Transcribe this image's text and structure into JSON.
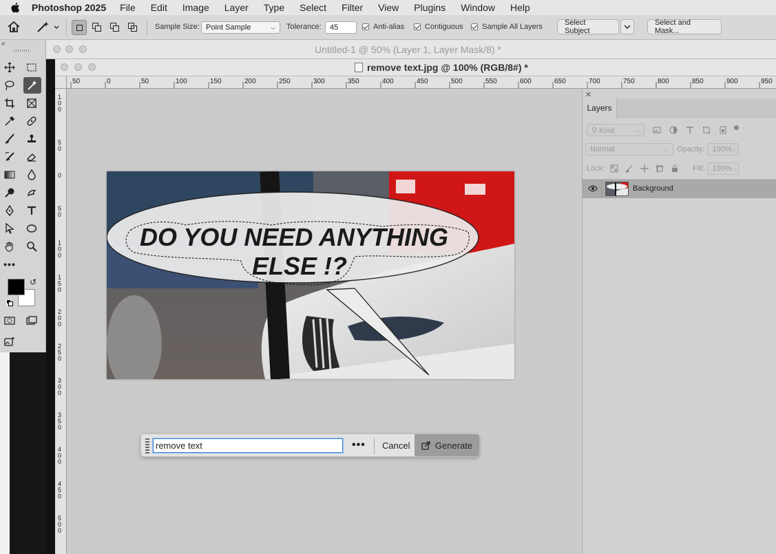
{
  "menubar": {
    "app_name": "Photoshop 2025",
    "items": [
      "File",
      "Edit",
      "Image",
      "Layer",
      "Type",
      "Select",
      "Filter",
      "View",
      "Plugins",
      "Window",
      "Help"
    ]
  },
  "options": {
    "sample_size_label": "Sample Size:",
    "sample_size_value": "Point Sample",
    "tolerance_label": "Tolerance:",
    "tolerance_value": "45",
    "anti_alias": "Anti-alias",
    "contiguous": "Contiguous",
    "sample_all_layers": "Sample All Layers",
    "select_subject": "Select Subject",
    "select_and_mask": "Select and Mask..."
  },
  "documents": {
    "back_title": "Untitled-1 @ 50% (Layer 1, Layer Mask/8) *",
    "front_title": "remove text.jpg @ 100% (RGB/8#) *"
  },
  "rulers": {
    "h_ticks": [
      "50",
      "0",
      "50",
      "100",
      "150",
      "200",
      "250",
      "300",
      "350",
      "400",
      "450",
      "500",
      "550",
      "600",
      "650",
      "700",
      "750",
      "800",
      "850",
      "900",
      "950"
    ],
    "v_ticks": [
      "100",
      "50",
      "0",
      "50",
      "100",
      "150",
      "200",
      "250",
      "300",
      "350",
      "400",
      "450",
      "500"
    ]
  },
  "image": {
    "bubble_line1": "DO YOU NEED ANYTHING",
    "bubble_line2": "ELSE !?"
  },
  "generate_bar": {
    "prompt_value": "remove text",
    "more_label": "•••",
    "cancel_label": "Cancel",
    "generate_label": "Generate"
  },
  "layers_panel": {
    "tab": "Layers",
    "filter_kind": "Kind",
    "blend_mode": "Normal",
    "opacity_label": "Opacity:",
    "opacity_value": "100%",
    "lock_label": "Lock:",
    "fill_label": "Fill:",
    "fill_value": "100%",
    "layers": [
      {
        "name": "Background",
        "visible": true,
        "selected": true
      }
    ]
  }
}
